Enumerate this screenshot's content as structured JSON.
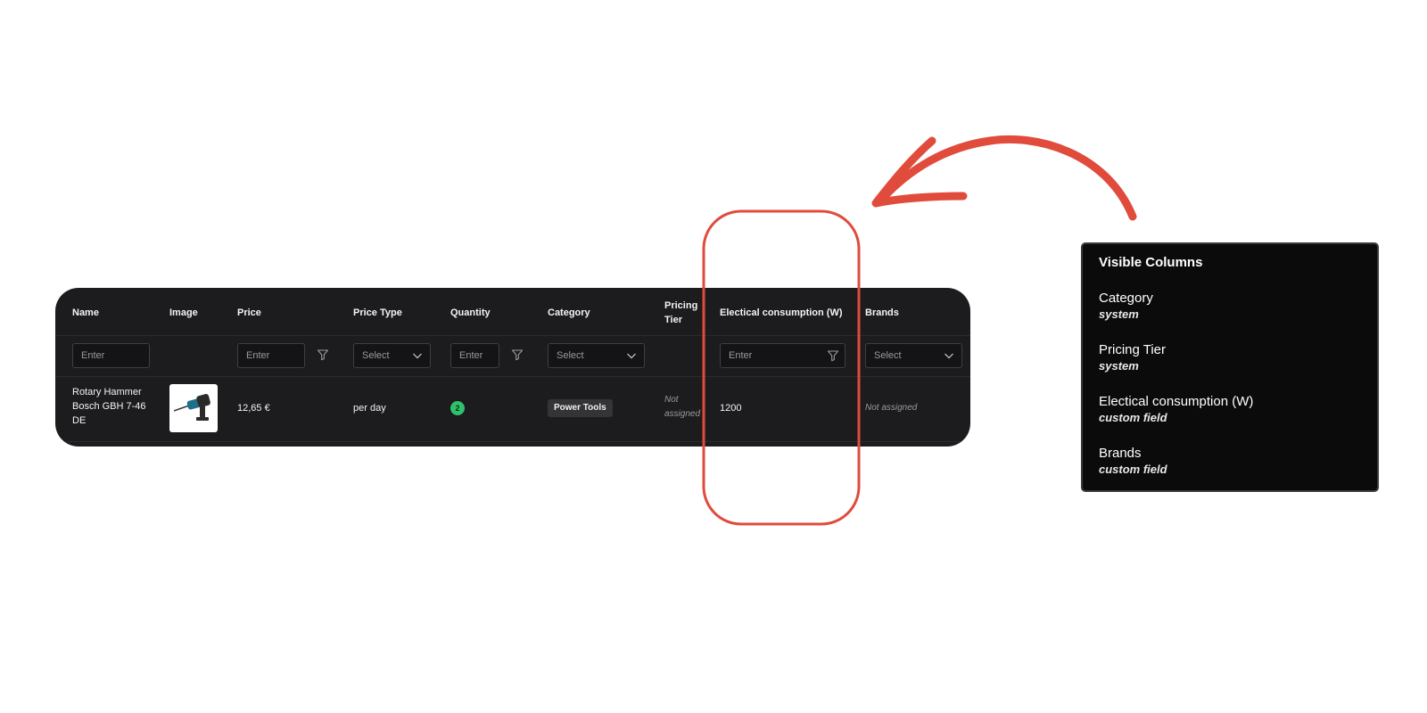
{
  "table": {
    "headers": {
      "name": "Name",
      "image": "Image",
      "price": "Price",
      "price_type": "Price Type",
      "quantity": "Quantity",
      "category": "Category",
      "pricing_tier": "Pricing Tier",
      "electrical": "Electical consumption (W)",
      "brands": "Brands"
    },
    "filters": {
      "name": "Enter",
      "price": "Enter",
      "price_type": "Select",
      "quantity": "Enter",
      "category": "Select",
      "electrical": "Enter",
      "brands": "Select"
    },
    "row": {
      "name": "Rotary Hammer Bosch GBH 7-46 DE",
      "image_icon": "rotary-hammer-product-image",
      "price": "12,65 €",
      "price_type": "per day",
      "quantity": "2",
      "category": "Power Tools",
      "pricing_tier": "Not assigned",
      "electrical": "1200",
      "brands": "Not assigned"
    }
  },
  "panel": {
    "title": "Visible Columns",
    "items": [
      {
        "name": "Category",
        "type": "system"
      },
      {
        "name": "Pricing Tier",
        "type": "system"
      },
      {
        "name": "Electical consumption (W)",
        "type": "custom field"
      },
      {
        "name": "Brands",
        "type": "custom field"
      }
    ]
  },
  "colors": {
    "table_bg": "#1c1c1e",
    "panel_bg": "#0b0b0b",
    "highlight": "#e04b3c",
    "quantity_badge": "#2ec26b"
  }
}
